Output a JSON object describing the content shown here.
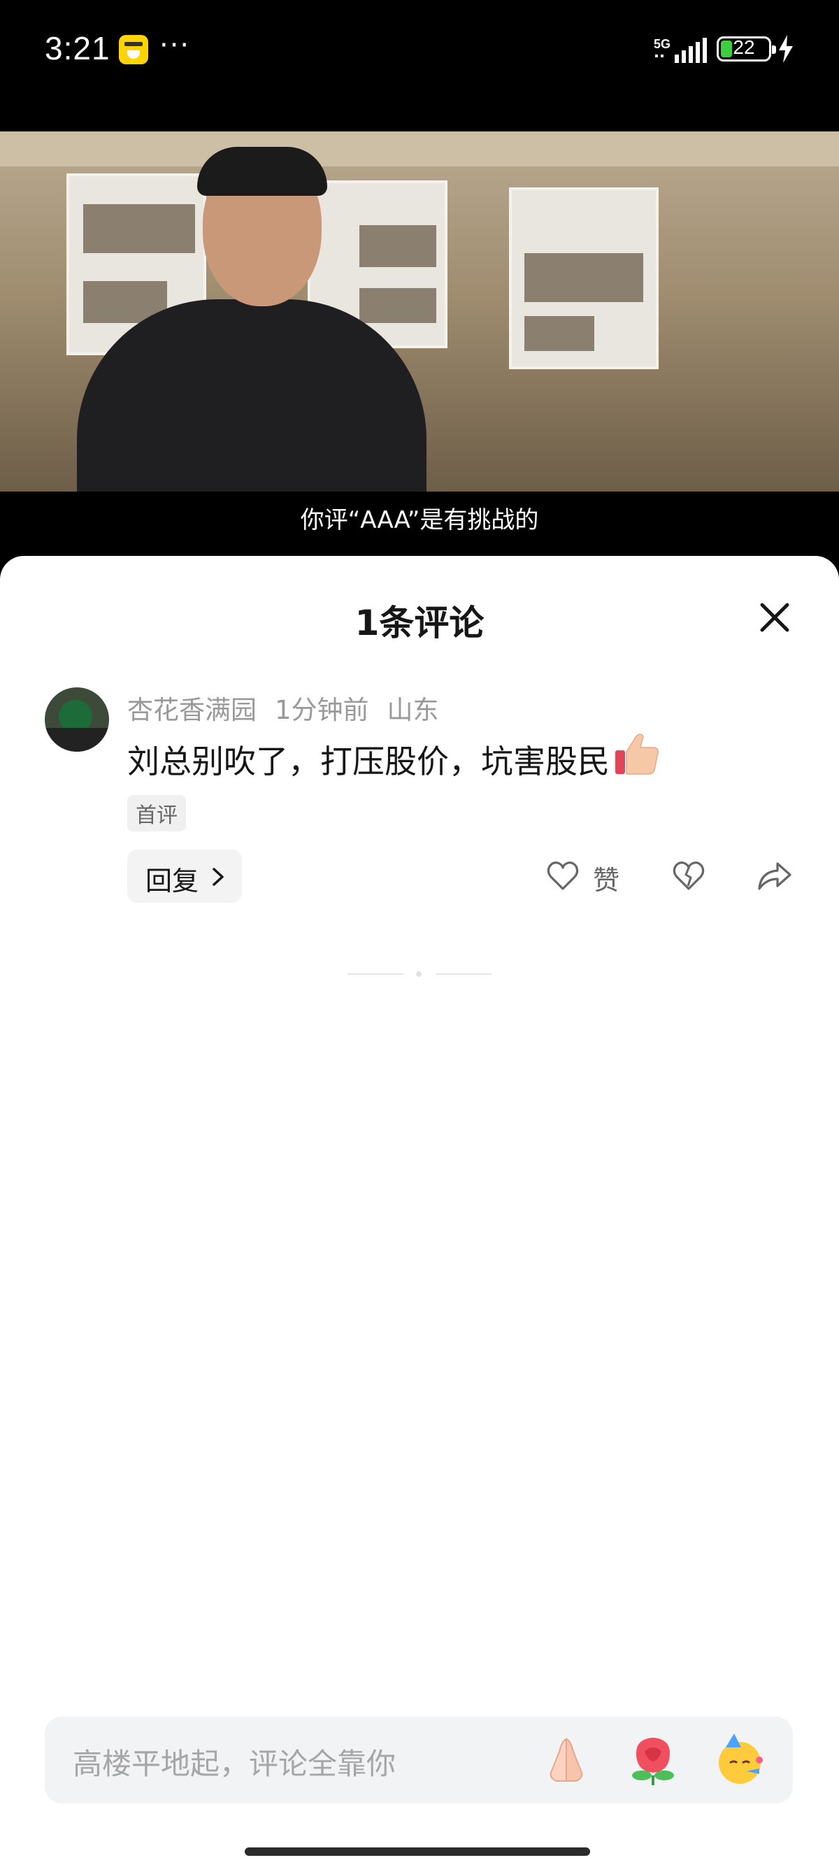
{
  "status_bar": {
    "time": "3:21",
    "more": "···",
    "network": "5G",
    "battery": "22"
  },
  "video": {
    "subtitle": "你评“AAA”是有挑战的"
  },
  "comments_sheet": {
    "title": "1条评论",
    "comment": {
      "username": "杏花香满园",
      "time": "1分钟前",
      "location": "山东",
      "text": "刘总别吹了，打压股价，坑害股民",
      "emoji": "thumbs-up",
      "badge": "首评",
      "reply_label": "回复",
      "like_label": "赞"
    }
  },
  "input": {
    "placeholder": "高楼平地起，评论全靠你",
    "quick_emojis": [
      "folded-hands",
      "rose",
      "party-face"
    ]
  },
  "colors": {
    "sheet_bg": "#ffffff",
    "input_bg": "#f2f3f5",
    "meta_text": "#999999"
  }
}
